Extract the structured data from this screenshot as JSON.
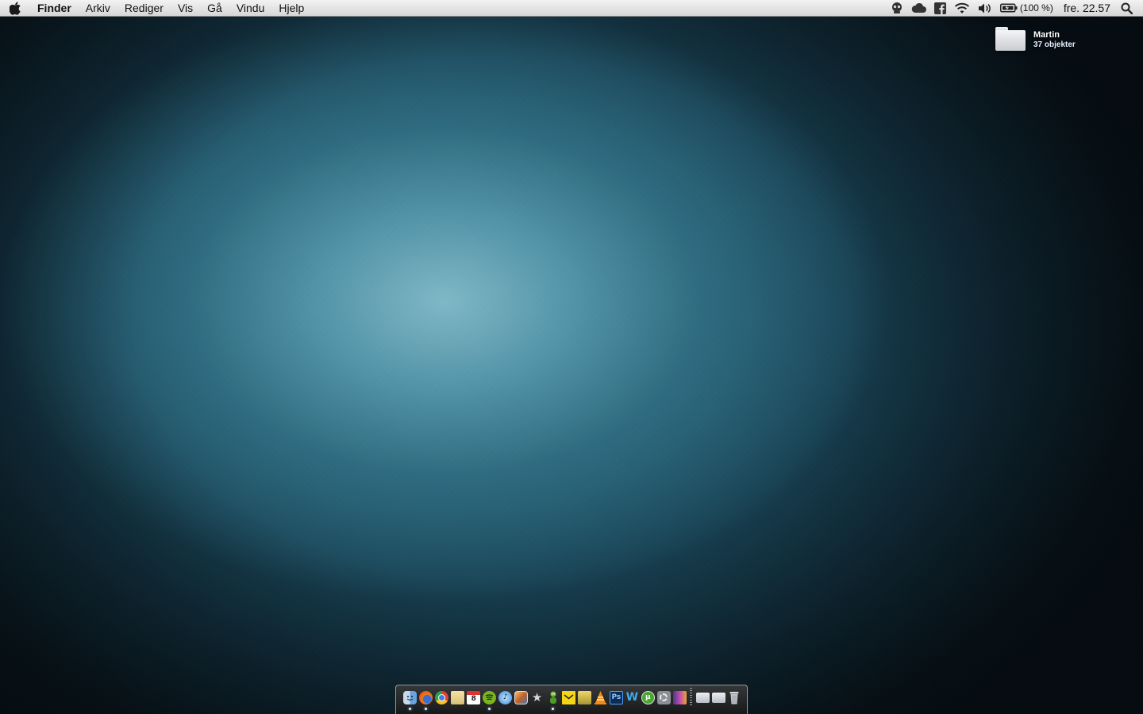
{
  "menubar": {
    "apple_icon": "apple-logo-icon",
    "app_name": "Finder",
    "menus": [
      "Arkiv",
      "Rediger",
      "Vis",
      "Gå",
      "Vindu",
      "Hjelp"
    ],
    "status_icons": [
      "alien-icon",
      "cloud-icon",
      "facebook-icon",
      "wifi-icon",
      "volume-icon",
      "battery-icon"
    ],
    "battery_text": "(100 %)",
    "clock": "fre. 22.57",
    "search_icon": "spotlight-search-icon"
  },
  "desktop": {
    "folder_name": "Martin",
    "folder_count": "37 objekter",
    "wallpaper_colors": [
      "#7fb9c8",
      "#2c6a80",
      "#081823"
    ]
  },
  "dock": {
    "apps": [
      {
        "icon": "finder-icon",
        "running": true
      },
      {
        "icon": "firefox-icon",
        "running": true
      },
      {
        "icon": "chrome-icon",
        "running": false
      },
      {
        "icon": "notes-icon",
        "running": false
      },
      {
        "icon": "calendar-icon",
        "glyph": "8",
        "running": false
      },
      {
        "icon": "spotify-icon",
        "running": true
      },
      {
        "icon": "itunes-icon",
        "running": false
      },
      {
        "icon": "iphoto-icon",
        "running": false
      },
      {
        "icon": "imovie-star-icon",
        "running": false
      },
      {
        "icon": "adium-icon",
        "running": true
      },
      {
        "icon": "mail-stamp-icon",
        "running": false
      },
      {
        "icon": "final-cut-icon",
        "running": false
      },
      {
        "icon": "vlc-icon",
        "running": false
      },
      {
        "icon": "photoshop-icon",
        "glyph": "Ps",
        "running": false
      },
      {
        "icon": "word-icon",
        "running": false
      },
      {
        "icon": "utorrent-icon",
        "running": false
      },
      {
        "icon": "system-preferences-icon",
        "running": false
      },
      {
        "icon": "photo-booth-icon",
        "running": false
      }
    ],
    "stacks": [
      {
        "icon": "documents-folder-icon"
      },
      {
        "icon": "downloads-folder-icon"
      },
      {
        "icon": "trash-icon"
      }
    ]
  }
}
